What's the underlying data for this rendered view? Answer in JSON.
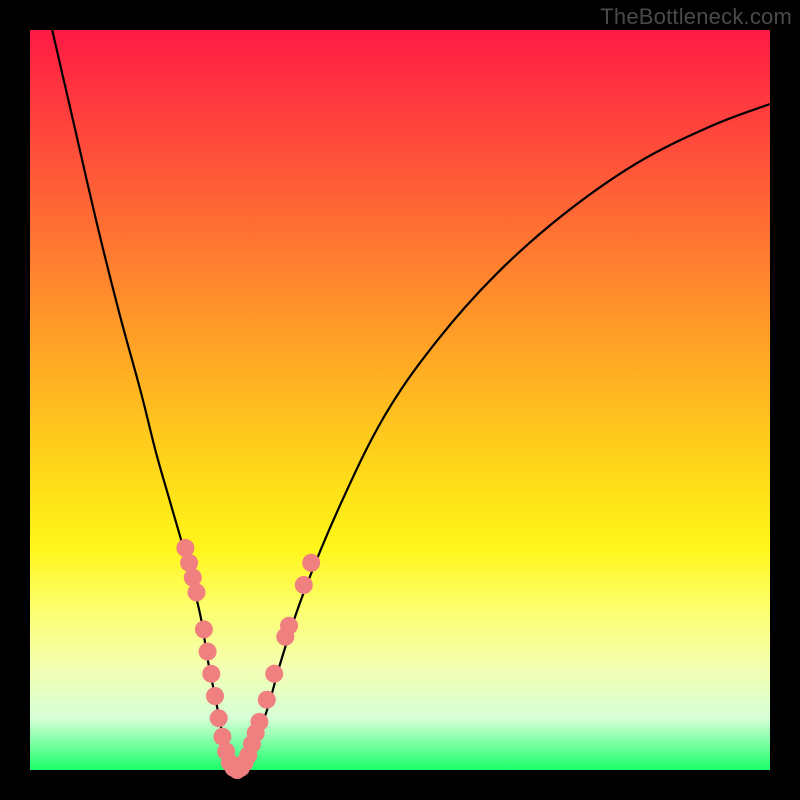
{
  "watermark": "TheBottleneck.com",
  "chart_data": {
    "type": "line",
    "title": "",
    "xlabel": "",
    "ylabel": "",
    "xlim": [
      0,
      100
    ],
    "ylim": [
      0,
      100
    ],
    "background_gradient_note": "Vertical rainbow gradient red (top, bad) to green (bottom, good) representing bottleneck-severity bands.",
    "series": [
      {
        "name": "bottleneck-curve",
        "x": [
          3,
          6,
          9,
          12,
          15,
          17,
          19,
          21,
          23,
          24,
          25,
          26,
          27,
          28,
          29,
          30,
          32,
          34,
          37,
          42,
          48,
          55,
          63,
          72,
          82,
          92,
          100
        ],
        "values": [
          100,
          87,
          74,
          62,
          51,
          43,
          36,
          29,
          21,
          15,
          10,
          5,
          2,
          0,
          1,
          3,
          8,
          15,
          24,
          36,
          48,
          58,
          67,
          75,
          82,
          87,
          90
        ]
      }
    ],
    "marker_points": {
      "name": "highlight-dots",
      "color": "#f08080",
      "points": [
        {
          "x": 21.0,
          "y": 30.0
        },
        {
          "x": 21.5,
          "y": 28.0
        },
        {
          "x": 22.0,
          "y": 26.0
        },
        {
          "x": 22.5,
          "y": 24.0
        },
        {
          "x": 23.5,
          "y": 19.0
        },
        {
          "x": 24.0,
          "y": 16.0
        },
        {
          "x": 24.5,
          "y": 13.0
        },
        {
          "x": 25.0,
          "y": 10.0
        },
        {
          "x": 25.5,
          "y": 7.0
        },
        {
          "x": 26.0,
          "y": 4.5
        },
        {
          "x": 26.5,
          "y": 2.5
        },
        {
          "x": 27.0,
          "y": 1.0
        },
        {
          "x": 27.5,
          "y": 0.3
        },
        {
          "x": 28.0,
          "y": 0.0
        },
        {
          "x": 28.5,
          "y": 0.3
        },
        {
          "x": 29.0,
          "y": 1.0
        },
        {
          "x": 29.5,
          "y": 2.0
        },
        {
          "x": 30.0,
          "y": 3.5
        },
        {
          "x": 30.5,
          "y": 5.0
        },
        {
          "x": 31.0,
          "y": 6.5
        },
        {
          "x": 32.0,
          "y": 9.5
        },
        {
          "x": 33.0,
          "y": 13.0
        },
        {
          "x": 34.5,
          "y": 18.0
        },
        {
          "x": 35.0,
          "y": 19.5
        },
        {
          "x": 37.0,
          "y": 25.0
        },
        {
          "x": 38.0,
          "y": 28.0
        }
      ]
    }
  }
}
